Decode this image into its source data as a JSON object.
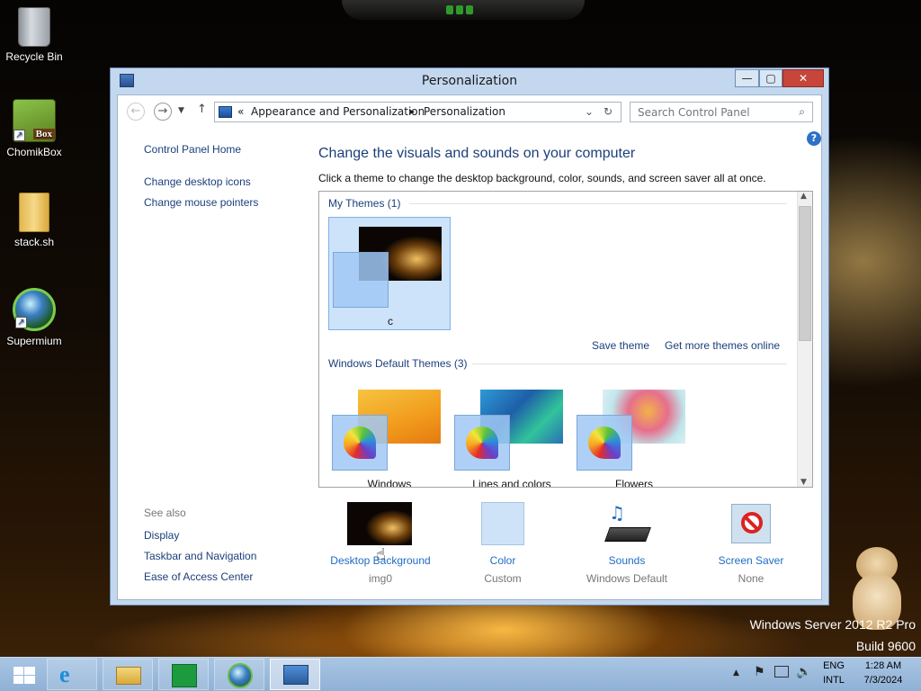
{
  "desktop": {
    "icons": [
      {
        "label": "Recycle Bin"
      },
      {
        "label": "ChomikBox",
        "badge": "Box"
      },
      {
        "label": "stack.sh"
      },
      {
        "label": "Supermium"
      }
    ],
    "watermark_line1": "Windows Server 2012 R2 Pro",
    "watermark_line2": "Build 9600"
  },
  "window": {
    "title": "Personalization",
    "controls": {
      "minimize": "—",
      "maximize": "▢",
      "close": "✕"
    },
    "address": {
      "prefix": "«",
      "crumb1": "Appearance and Personalization",
      "sep": "▸",
      "crumb2": "Personalization"
    },
    "search_placeholder": "Search Control Panel",
    "left_pane": {
      "home": "Control Panel Home",
      "links": [
        "Change desktop icons",
        "Change mouse pointers"
      ],
      "see_also_title": "See also",
      "see_also": [
        "Display",
        "Taskbar and Navigation",
        "Ease of Access Center"
      ]
    },
    "heading": "Change the visuals and sounds on your computer",
    "subheading": "Click a theme to change the desktop background, color, sounds, and screen saver all at once.",
    "my_themes": {
      "label": "My Themes (1)",
      "themes": [
        {
          "name": "c"
        }
      ],
      "save_theme": "Save theme",
      "get_more": "Get more themes online"
    },
    "default_themes": {
      "label": "Windows Default Themes (3)",
      "themes": [
        {
          "name": "Windows"
        },
        {
          "name": "Lines and colors"
        },
        {
          "name": "Flowers"
        }
      ]
    },
    "bottom": [
      {
        "title": "Desktop Background",
        "sub": "img0"
      },
      {
        "title": "Color",
        "sub": "Custom"
      },
      {
        "title": "Sounds",
        "sub": "Windows Default"
      },
      {
        "title": "Screen Saver",
        "sub": "None"
      }
    ]
  },
  "taskbar": {
    "lang1": "ENG",
    "lang2": "INTL",
    "time": "1:28 AM",
    "date": "7/3/2024"
  },
  "colors": {
    "accent_link": "#1f6bc5",
    "selected_theme": "#cce3fa",
    "taskbar": "#9dbde0"
  }
}
